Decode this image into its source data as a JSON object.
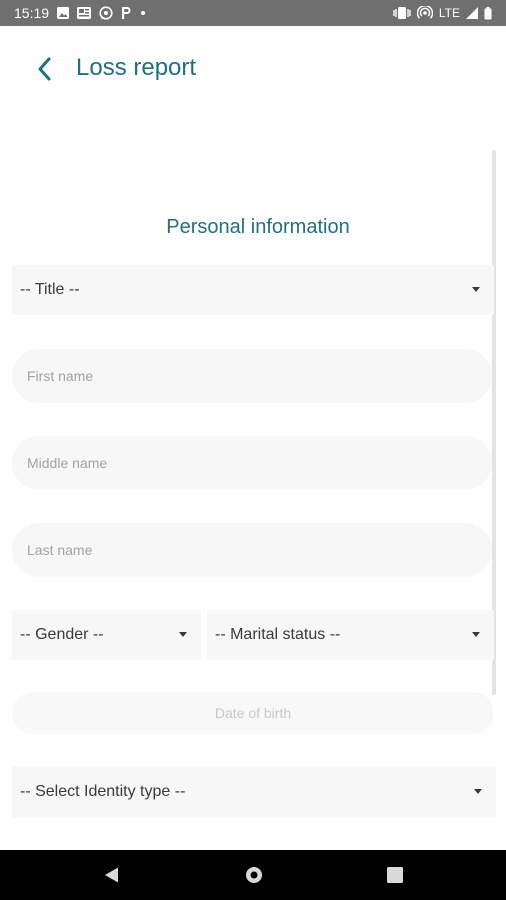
{
  "status_bar": {
    "time": "15:19",
    "network": "LTE",
    "icons": [
      "gallery-icon",
      "news-icon",
      "whatsapp-icon",
      "p-icon",
      "dot-icon",
      "vibrate-icon",
      "hotspot-icon",
      "signal-icon",
      "battery-icon"
    ]
  },
  "app_bar": {
    "title": "Loss report",
    "back_icon": "chevron-left-icon",
    "accent_color": "#1f6f86"
  },
  "form": {
    "section_title": "Personal information",
    "title_select": "-- Title --",
    "first_name_placeholder": "First name",
    "middle_name_placeholder": "Middle name",
    "last_name_placeholder": "Last name",
    "gender_select": "-- Gender --",
    "marital_status_select": "-- Marital status --",
    "date_of_birth_placeholder": "Date of birth",
    "identity_type_select": "-- Select Identity type --"
  },
  "nav_bar": {
    "buttons": [
      "back-triangle-icon",
      "home-circle-icon",
      "recents-square-icon"
    ]
  }
}
